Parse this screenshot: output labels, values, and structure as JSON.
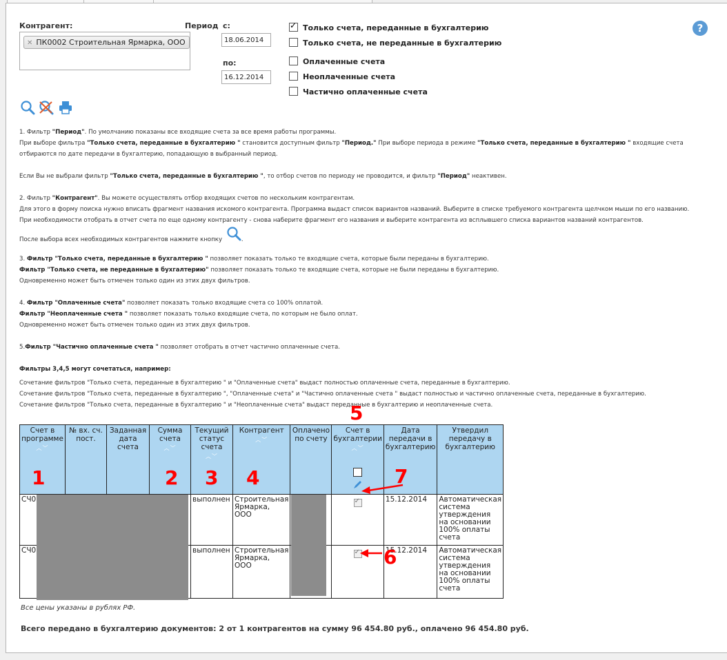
{
  "filters": {
    "kontragent_label": "Контрагент:",
    "period_label": "Период",
    "from_label": "с:",
    "to_label": "по:",
    "from_value": "18.06.2014",
    "to_value": "16.12.2014",
    "selected_kontragent": "ПК0002 Строительная Ярмарка, ООО",
    "checkboxes": [
      {
        "label": "Только счета, переданные в бухгалтерию",
        "checked": true
      },
      {
        "label": "Только счета, не переданные в бухгалтерию",
        "checked": false
      },
      {
        "label": "Оплаченные счета",
        "checked": false
      },
      {
        "label": "Неоплаченные счета",
        "checked": false
      },
      {
        "label": "Частично оплаченные счета",
        "checked": false
      }
    ]
  },
  "help_glyph": "?",
  "help": {
    "p1_a": "1. Фильтр ",
    "p1_b": "\"Период\"",
    "p1_c": ". По умолчанию показаны все входящие счета за все время работы программы.",
    "p2_a": "При выборе фильтра ",
    "p2_b": "\"Только счета, переданные в бухгалтерию \"",
    "p2_c": " становится доступным фильтр ",
    "p2_d": "\"Период.\"",
    "p2_e": " При выборе периода в режиме ",
    "p2_f": "\"Только счета, переданные в бухгалтерию \"",
    "p2_g": " входящие счета",
    "p3": "отбираются по дате передачи в бухгалтерию, попадающую в выбранный период.",
    "p4_a": "Если Вы не выбрали фильтр ",
    "p4_b": "\"Только счета, переданные в бухгалтерию \"",
    "p4_c": ", то отбор счетов по периоду не проводится, и фильтр ",
    "p4_d": "\"Период\"",
    "p4_e": " неактивен.",
    "p5_a": "2. Фильтр ",
    "p5_b": "\"Контрагент\"",
    "p5_c": ". Вы можете осуществлять отбор входящих счетов по нескольким контрагентам.",
    "p6": "Для этого в форму поиска нужно вписать фрагмент названия искомого контрагента. Программа выдаст список вариантов названий. Выберите в списке требуемого контрагента щелчком мыши по его названию.",
    "p7": "При необходимости отобрать в отчет счета по еще одному контрагенту - снова наберите фрагмент его названия и выберите контрагента из всплывшего списка вариантов названий контрагентов.",
    "p8": "После выбора всех необходимых контрагентов нажмите кнопку",
    "p8_end": ".",
    "p9_a": "3. ",
    "p9_b": "Фильтр \"Только счета, переданные в бухгалтерию \"",
    "p9_c": " позволяет показать только те входящие счета, которые были переданы в бухгалтерию.",
    "p10_b": "Фильтр \"Только счета, не переданные в бухгалтерию\"",
    "p10_c": " позволяет показать только те входящие счета, которые не были переданы в бухгалтерию.",
    "p11": "Одновременно может быть отмечен только один из этих двух фильтров.",
    "p12_a": "4. ",
    "p12_b": "Фильтр \"Оплаченные счета\"",
    "p12_c": " позволяет показать только входящие счета со 100% оплатой.",
    "p13_b": "Фильтр \"Неоплаченные счета \"",
    "p13_c": " позволяет показать только входящие счета, по которым не было оплат.",
    "p14": "Одновременно может быть отмечен только один из этих двух фильтров.",
    "p15_a": "5.",
    "p15_b": "Фильтр \"Частично оплаченные счета \"",
    "p15_c": " позволяет отобрать в отчет частично оплаченные счета.",
    "p16": "Фильтры 3,4,5 могут сочетаться, например:",
    "p17": "Сочетание фильтров \"Только счета, переданные в бухгалтерию \" и \"Оплаченные счета\" выдаст полностью оплаченные счета, переданные в бухгалтерию.",
    "p18": "Сочетание фильтров \"Только счета, переданные в бухгалтерию \", \"Оплаченные счета\" и \"Частично оплаченные счета \" выдаст полностью и частично оплаченные счета, переданные в бухгалтерию.",
    "p19": "Сочетание фильтров \"Только счета, переданные в бухгалтерию \" и \"Неоплаченные счета\" выдаст переданные в бухгалтерию и неоплаченные счета."
  },
  "table": {
    "columns": [
      "Счет в программе",
      "№ вх. сч. пост.",
      "Заданная дата счета",
      "Сумма счета",
      "Текущий статус счета",
      "Контрагент",
      "Оплачено по счету",
      "Счет в бухгалтерии",
      "Дата передачи в бухгалтерию",
      "Утвердил передачу в бухгалтерию"
    ],
    "sort_glyph": "︿﹀",
    "rows": [
      {
        "invoice": "СЧ0",
        "status": "выполнен",
        "kontragent": "Строительная Ярмарка, ООО",
        "date": "15.12.2014",
        "approved": "Автоматическая система утверждения на основании 100% оплаты счета"
      },
      {
        "invoice": "СЧ0",
        "status": "выполнен",
        "kontragent": "Строительная Ярмарка, ООО",
        "date": "15.12.2014",
        "approved": "Автоматическая система утверждения на основании 100% оплаты счета"
      }
    ]
  },
  "annotations": [
    "1",
    "2",
    "3",
    "4",
    "5",
    "6",
    "7"
  ],
  "footer": {
    "note": "Все цены указаны в рублях РФ.",
    "total": "Всего передано в бухгалтерию документов: 2 от 1 контрагентов на сумму 96 454.80 руб., оплачено 96 454.80 руб."
  },
  "colors": {
    "header_bg": "#aed6f1",
    "annotation": "#ff0000",
    "icon_blue": "#3d8fd6"
  }
}
